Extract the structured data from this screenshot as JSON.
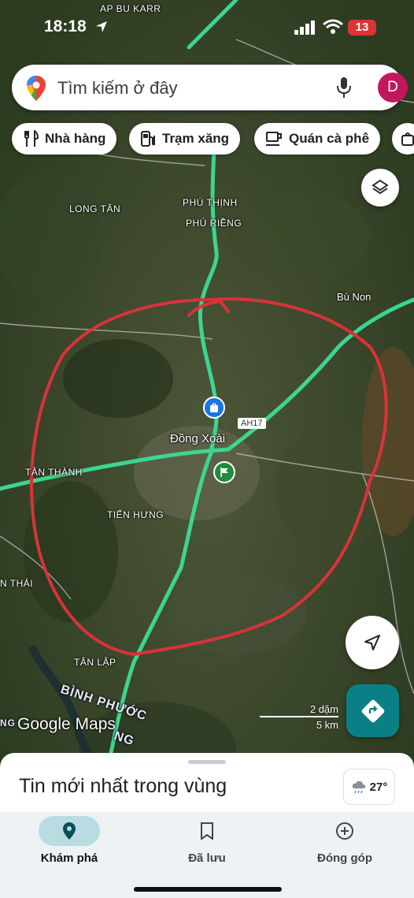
{
  "status_bar": {
    "time": "18:18",
    "battery": "13"
  },
  "search": {
    "placeholder": "Tìm kiếm ở đây",
    "avatar_letter": "D"
  },
  "chips": [
    {
      "label": "Nhà hàng",
      "icon": "fork-knife-icon"
    },
    {
      "label": "Trạm xăng",
      "icon": "gas-pump-icon"
    },
    {
      "label": "Quán cà phê",
      "icon": "coffee-cup-icon"
    }
  ],
  "map_labels": {
    "ap_bu_karr": "AP BU KARR",
    "long_tan": "LONG TÂN",
    "phu_thinh": "PHÚ THỊNH",
    "phu_rieng": "PHÚ RIỀNG",
    "bu_non": "Bù Non",
    "ah17": "AH17",
    "dong_xoai": "Đồng Xoài",
    "tan_thanh": "TÂN THÀNH",
    "tien_hung": "TIẾN HƯNG",
    "tan_thai": "N THÁI",
    "tan_lap": "TÂN LẬP",
    "binh_phuoc": "BÌNH PHƯỚC",
    "province_ng_left": "NG",
    "province_ng_right": "NG"
  },
  "watermark": "Google Maps",
  "scale": {
    "imperial": "2 dặm",
    "metric": "5 km"
  },
  "sheet": {
    "title": "Tin mới nhất trong vùng",
    "temperature": "27°"
  },
  "nav": [
    {
      "label": "Khám phá",
      "icon": "explore-pin-icon",
      "active": true
    },
    {
      "label": "Đã lưu",
      "icon": "bookmark-icon",
      "active": false
    },
    {
      "label": "Đóng góp",
      "icon": "add-circle-icon",
      "active": false
    }
  ],
  "colors": {
    "road": "#3ddc97",
    "circle": "#d9323a",
    "accent": "#0b7f86",
    "avatar": "#c2185b"
  }
}
